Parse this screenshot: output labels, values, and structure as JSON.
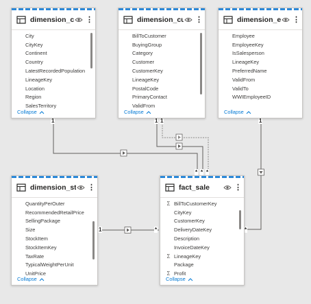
{
  "tables": [
    {
      "name": "dimension_city",
      "fields": [
        {
          "label": "City",
          "sigma": false
        },
        {
          "label": "CityKey",
          "sigma": false
        },
        {
          "label": "Continent",
          "sigma": false
        },
        {
          "label": "Country",
          "sigma": false
        },
        {
          "label": "LatestRecordedPopulation",
          "sigma": false
        },
        {
          "label": "LineageKey",
          "sigma": false
        },
        {
          "label": "Location",
          "sigma": false
        },
        {
          "label": "Region",
          "sigma": false
        },
        {
          "label": "SalesTerritory",
          "sigma": false
        }
      ],
      "collapse": "Collapse"
    },
    {
      "name": "dimension_customer",
      "fields": [
        {
          "label": "BillToCustomer",
          "sigma": false
        },
        {
          "label": "BuyingGroup",
          "sigma": false
        },
        {
          "label": "Category",
          "sigma": false
        },
        {
          "label": "Customer",
          "sigma": false
        },
        {
          "label": "CustomerKey",
          "sigma": false
        },
        {
          "label": "LineageKey",
          "sigma": false
        },
        {
          "label": "PostalCode",
          "sigma": false
        },
        {
          "label": "PrimaryContact",
          "sigma": false
        },
        {
          "label": "ValidFrom",
          "sigma": false
        }
      ],
      "collapse": "Collapse"
    },
    {
      "name": "dimension_employee",
      "fields": [
        {
          "label": "Employee",
          "sigma": false
        },
        {
          "label": "EmployeeKey",
          "sigma": false
        },
        {
          "label": "IsSalesperson",
          "sigma": false
        },
        {
          "label": "LineageKey",
          "sigma": false
        },
        {
          "label": "PreferredName",
          "sigma": false
        },
        {
          "label": "ValidFrom",
          "sigma": false
        },
        {
          "label": "ValidTo",
          "sigma": false
        },
        {
          "label": "WWIEmployeeID",
          "sigma": false
        }
      ],
      "collapse": "Collapse"
    },
    {
      "name": "dimension_stock_item",
      "fields": [
        {
          "label": "QuantityPerOuter",
          "sigma": false
        },
        {
          "label": "RecommendedRetailPrice",
          "sigma": false
        },
        {
          "label": "SellingPackage",
          "sigma": false
        },
        {
          "label": "Size",
          "sigma": false
        },
        {
          "label": "StockItem",
          "sigma": false
        },
        {
          "label": "StockItemKey",
          "sigma": false
        },
        {
          "label": "TaxRate",
          "sigma": false
        },
        {
          "label": "TypicalWeightPerUnit",
          "sigma": false
        },
        {
          "label": "UnitPrice",
          "sigma": false
        }
      ],
      "collapse": "Collapse"
    },
    {
      "name": "fact_sale",
      "fields": [
        {
          "label": "BillToCustomerKey",
          "sigma": true
        },
        {
          "label": "CityKey",
          "sigma": false
        },
        {
          "label": "CustomerKey",
          "sigma": false
        },
        {
          "label": "DeliveryDateKey",
          "sigma": false
        },
        {
          "label": "Description",
          "sigma": false
        },
        {
          "label": "InvoiceDateKey",
          "sigma": false
        },
        {
          "label": "LineageKey",
          "sigma": true
        },
        {
          "label": "Package",
          "sigma": false
        },
        {
          "label": "Profit",
          "sigma": true
        }
      ],
      "collapse": "Collapse"
    }
  ],
  "cardinality": {
    "one": "1",
    "many": "*"
  },
  "colors": {
    "accent": "#2b88d8",
    "link": "#0078d4",
    "line": "#605e5c"
  }
}
